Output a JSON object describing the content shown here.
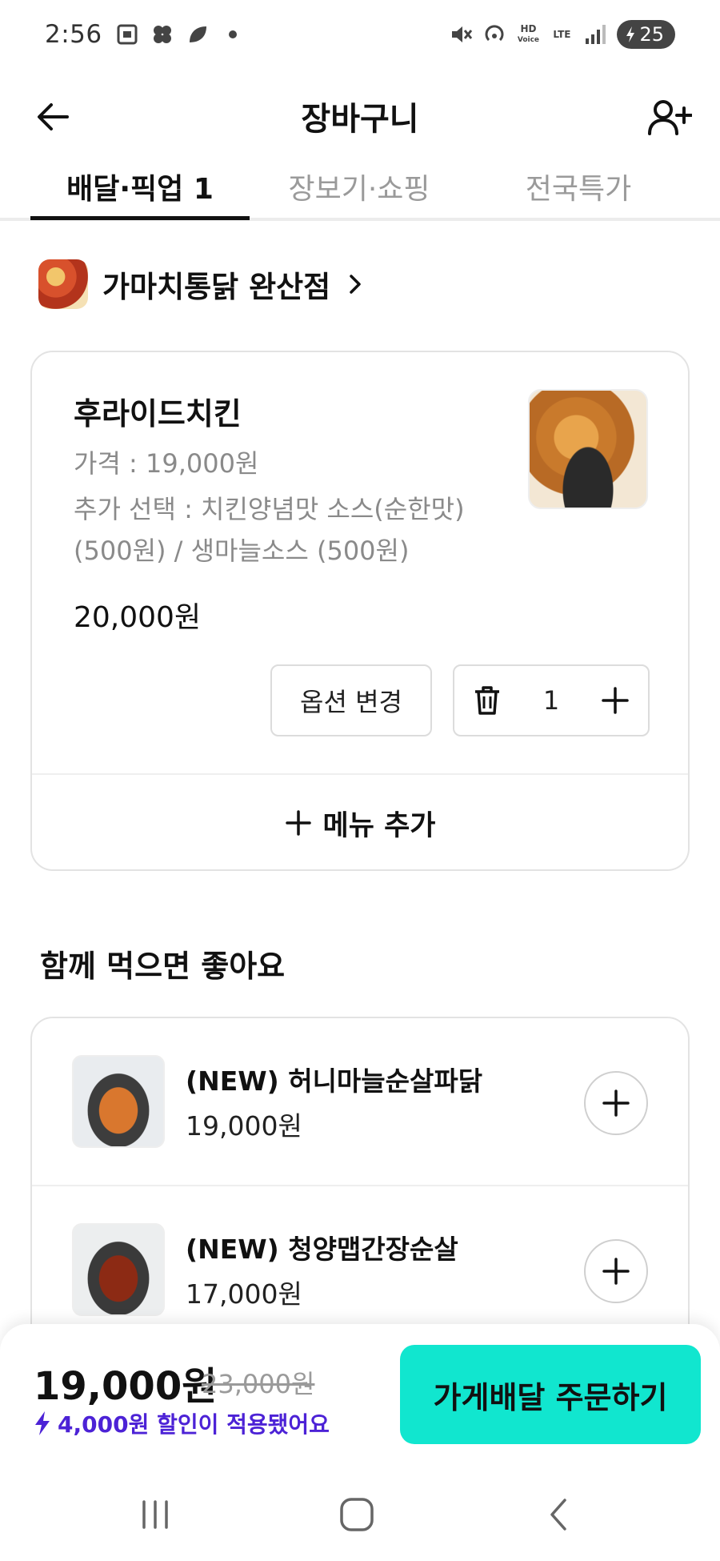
{
  "status_bar": {
    "time": "2:56",
    "battery": "25",
    "hd_label": "HD",
    "voice_label": "Voice",
    "lte_label": "LTE"
  },
  "header": {
    "title": "장바구니"
  },
  "tabs": [
    {
      "label": "배달·픽업 1",
      "active": true
    },
    {
      "label": "장보기·쇼핑",
      "active": false
    },
    {
      "label": "전국특가",
      "active": false
    }
  ],
  "store": {
    "name": "가마치통닭 완산점"
  },
  "cart_item": {
    "name": "후라이드치킨",
    "price_line": "가격 : 19,000원",
    "options_line1": "추가 선택 : 치킨양념맛 소스(순한맛)",
    "options_line2": "(500원) / 생마늘소스 (500원)",
    "total": "20,000원",
    "option_change_label": "옵션 변경",
    "quantity": "1",
    "add_menu_label": "메뉴 추가"
  },
  "recommend": {
    "title": "함께 먹으면 좋아요",
    "items": [
      {
        "name": "(NEW) 허니마늘순살파닭",
        "price": "19,000원"
      },
      {
        "name": "(NEW) 청양맵간장순살",
        "price": "17,000원"
      }
    ]
  },
  "order": {
    "final_price": "19,000원",
    "original_price": "23,000원",
    "discount_note": "4,000원 할인이 적용됐어요",
    "button_label": "가게배달 주문하기",
    "accent_color": "#11e6cf",
    "discount_color": "#4c22d6"
  },
  "icons": [
    "back-arrow-icon",
    "add-friend-icon",
    "chevron-right-icon",
    "trash-icon",
    "plus-icon",
    "lightning-icon",
    "recent-apps-icon",
    "home-icon",
    "back-nav-icon"
  ]
}
